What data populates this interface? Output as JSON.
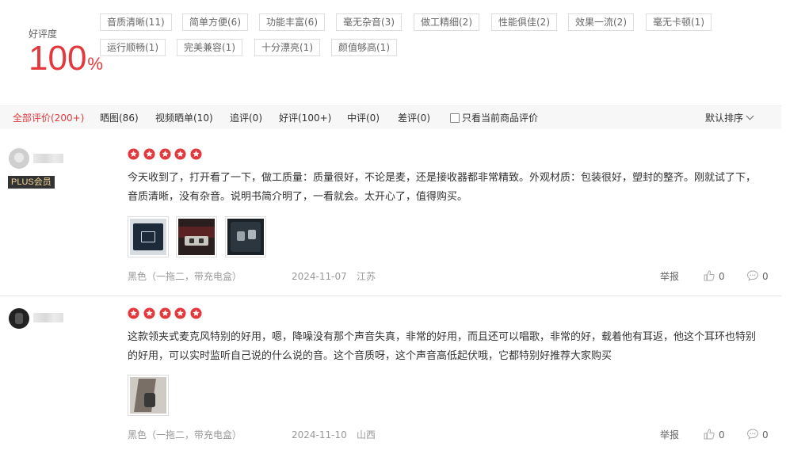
{
  "summary": {
    "label": "好评度",
    "value": "100",
    "unit": "%"
  },
  "tags": [
    "音质清晰(11)",
    "简单方便(6)",
    "功能丰富(6)",
    "毫无杂音(3)",
    "做工精细(2)",
    "性能俱佳(2)",
    "效果一流(2)",
    "毫无卡顿(1)",
    "运行顺畅(1)",
    "完美兼容(1)",
    "十分漂亮(1)",
    "颜值够高(1)"
  ],
  "filters": [
    {
      "label": "全部评价(200+)",
      "active": true
    },
    {
      "label": "晒图(86)",
      "active": false
    },
    {
      "label": "视频晒单(10)",
      "active": false
    },
    {
      "label": "追评(0)",
      "active": false
    },
    {
      "label": "好评(100+)",
      "active": false
    },
    {
      "label": "中评(0)",
      "active": false
    },
    {
      "label": "差评(0)",
      "active": false
    }
  ],
  "only_current_label": "只看当前商品评价",
  "sort_label": "默认排序",
  "comments": [
    {
      "badge": "PLUS会员",
      "stars": 5,
      "text": "今天收到了，打开看了一下，做工质量：质量很好，不论是麦，还是接收器都非常精致。外观材质：包装很好，塑封的整齐。刚就试了下，音质清晰，没有杂音。说明书简介明了，一看就会。太开心了，值得购买。",
      "product": "黑色（一拖二，带充电盒）",
      "date": "2024-11-07",
      "region": "江苏",
      "report_label": "举报",
      "likes": "0",
      "replies": "0"
    },
    {
      "stars": 5,
      "text": "这款领夹式麦克风特别的好用，嗯，降噪没有那个声音失真，非常的好用，而且还可以唱歌，非常的好，载着他有耳返，他这个耳环也特别的好用，可以实时监听自己说的什么说的音。这个音质呀，这个声音高低起伏哦，它都特别好推荐大家购买",
      "product": "黑色（一拖二，带充电盒）",
      "date": "2024-11-10",
      "region": "山西",
      "report_label": "举报",
      "likes": "0",
      "replies": "0"
    }
  ],
  "colors": {
    "accent": "#e4393c",
    "muted": "#999999"
  }
}
